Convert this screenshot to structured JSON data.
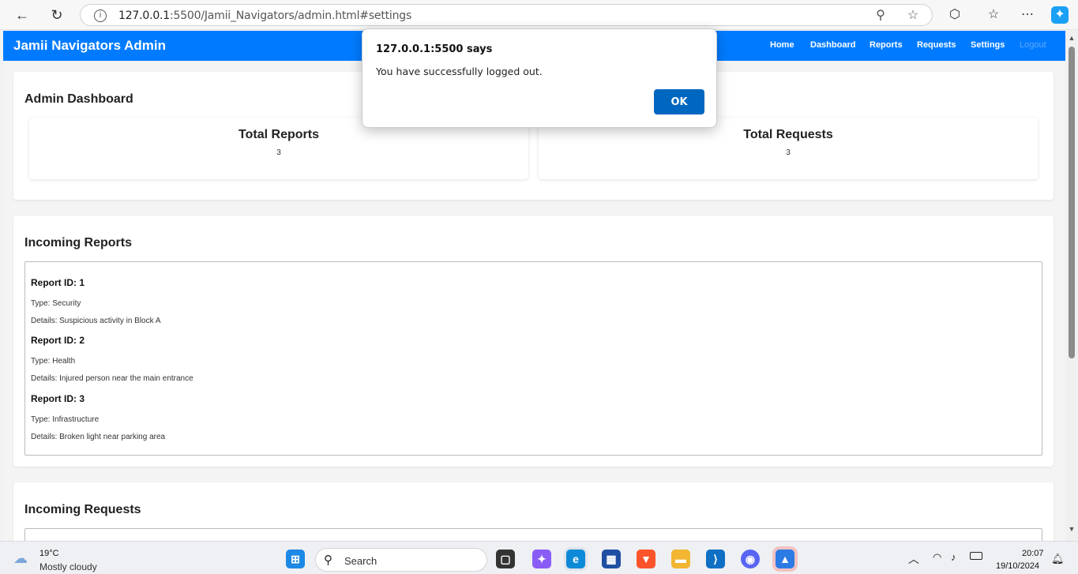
{
  "browser": {
    "url_host": "127.0.0.1",
    "url_rest": ":5500/Jamii_Navigators/admin.html#settings"
  },
  "header": {
    "brand": "Jamii Navigators Admin",
    "nav": [
      "Home",
      "Dashboard",
      "Reports",
      "Requests",
      "Settings",
      "Logout"
    ]
  },
  "dashboard": {
    "title": "Admin Dashboard",
    "total_reports_label": "Total Reports",
    "total_reports_value": "3",
    "total_requests_label": "Total Requests",
    "total_requests_value": "3"
  },
  "reports": {
    "title": "Incoming Reports",
    "items": [
      {
        "id": "Report ID: 1",
        "type": "Type: Security",
        "details": "Details: Suspicious activity in Block A"
      },
      {
        "id": "Report ID: 2",
        "type": "Type: Health",
        "details": "Details: Injured person near the main entrance"
      },
      {
        "id": "Report ID: 3",
        "type": "Type: Infrastructure",
        "details": "Details: Broken light near parking area"
      }
    ]
  },
  "requests": {
    "title": "Incoming Requests"
  },
  "dialog": {
    "title": "127.0.0.1:5500 says",
    "message": "You have successfully logged out.",
    "ok_label": "OK"
  },
  "taskbar": {
    "temperature": "19°C",
    "weather": "Mostly cloudy",
    "search_label": "Search",
    "time": "20:07",
    "date": "19/10/2024"
  },
  "colors": {
    "header_bg": "#007bff",
    "ok_button": "#0067c0"
  }
}
